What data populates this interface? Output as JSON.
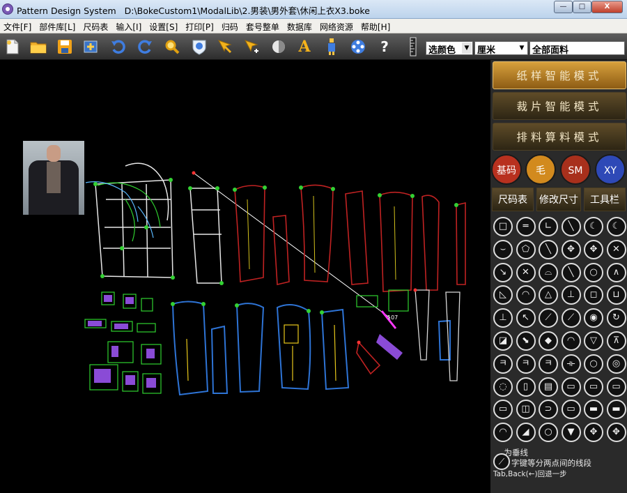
{
  "window": {
    "app_name": "Pattern Design System",
    "file_path": "D:\\BokeCustom1\\ModalLib\\2.男装\\男外套\\休闲上衣X3.boke",
    "min_label": "—",
    "max_label": "□",
    "close_label": "X"
  },
  "menu": [
    "文件[F]",
    "部件库[L]",
    "尺码表",
    "输入[I]",
    "设置[S]",
    "打印[P]",
    "归码",
    "套号整单",
    "数据库",
    "网络资源",
    "帮助[H]"
  ],
  "toolbar": {
    "icons": [
      "new-file-icon",
      "open-folder-icon",
      "save-icon",
      "add-icon",
      "undo-icon",
      "redo-icon",
      "zoom-icon",
      "shield-icon",
      "pointer-icon",
      "select-icon",
      "symmetry-icon",
      "text-icon",
      "figure-icon",
      "reel-icon",
      "help-icon",
      "ruler-icon"
    ],
    "text_label": "A",
    "help_label": "?",
    "color_select": "选颜色",
    "unit_select": "厘米",
    "fabric_select": "全部面料"
  },
  "panel": {
    "modes": [
      "纸样智能模式",
      "裁片智能模式",
      "排料算料模式"
    ],
    "circle_buttons": [
      {
        "label": "基码",
        "color": "#b8311f"
      },
      {
        "label": "毛",
        "color": "#d28a1e"
      },
      {
        "label": "SM",
        "color": "#a8301c"
      },
      {
        "label": "XY",
        "color": "#2e49b7"
      }
    ],
    "tabs": [
      "尺码表",
      "修改尺寸",
      "工具栏"
    ],
    "tools": [
      "□",
      "═",
      "∟",
      "╲",
      "☾",
      "☾",
      "⌣",
      "⬠",
      "╲",
      "✥",
      "✥",
      "✕",
      "↘",
      "✕",
      "⌓",
      "╲",
      "○",
      "∧",
      "◺",
      "◠",
      "△",
      "⊥",
      "◻",
      "⊔",
      "⊥",
      "↖",
      "⟋",
      "⟋",
      "◉",
      "↻",
      "◪",
      "⬊",
      "◆",
      "◠",
      "▽",
      "⊼",
      "ㅋ",
      "ㅋ",
      "ㅋ",
      "⟛",
      "○",
      "◎",
      "◌",
      "▯",
      "▤",
      "▭",
      "▭",
      "▭",
      "▭",
      "◫",
      "⊃",
      "▭",
      "▬",
      "▬",
      "◠",
      "◢",
      "○",
      "▼",
      "✥",
      "✥"
    ],
    "hints": [
      "…为垂线",
      "字键等分两点间的线段",
      "Tab,Back(←)回退一步"
    ]
  },
  "canvas": {
    "cursor_label": "107"
  }
}
